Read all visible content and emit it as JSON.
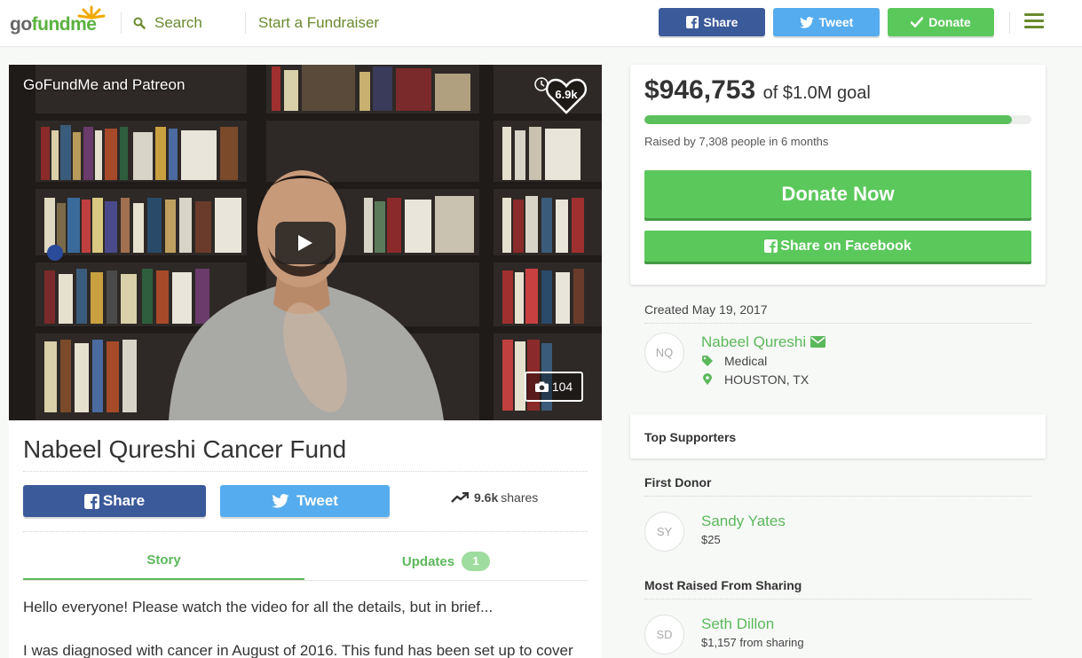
{
  "header": {
    "logo_go": "go",
    "logo_fund": "fundme",
    "search_label": "Search",
    "start_label": "Start a Fundraiser",
    "share_label": "Share",
    "tweet_label": "Tweet",
    "donate_label": "Donate",
    "colors": {
      "facebook": "#3b5a9a",
      "twitter": "#55acee",
      "green": "#5bc85b",
      "olive": "#6a8a2e"
    }
  },
  "video": {
    "title": "GoFundMe and Patreon",
    "hearts": "6.9k",
    "photo_count": "104"
  },
  "campaign": {
    "title": "Nabeel Qureshi Cancer Fund",
    "share_label": "Share",
    "tweet_label": "Tweet",
    "shares_count": "9.6k",
    "shares_label": "shares",
    "tabs": [
      {
        "label": "Story",
        "active": true
      },
      {
        "label": "Updates",
        "badge": "1",
        "active": false
      }
    ],
    "story": [
      "Hello everyone! Please watch the video for all the details, but in brief...",
      "I was diagnosed with cancer in August of 2016. This fund has been set up to cover"
    ]
  },
  "donation": {
    "raised": "$946,753",
    "goal_text": "of $1.0M goal",
    "progress_fraction": 0.95,
    "raised_by": "Raised by 7,308 people in 6 months",
    "donate_now": "Donate Now",
    "share_facebook": "Share on Facebook"
  },
  "organizer": {
    "created": "Created May 19, 2017",
    "initials": "NQ",
    "name": "Nabeel Qureshi",
    "category": "Medical",
    "location": "HOUSTON, TX"
  },
  "supporters": {
    "title": "Top Supporters",
    "first_donor_title": "First Donor",
    "first_donor": {
      "initials": "SY",
      "name": "Sandy Yates",
      "amount": "$25"
    },
    "most_raised_title": "Most Raised From Sharing",
    "most_raised": {
      "initials": "SD",
      "name": "Seth Dillon",
      "amount": "$1,157 from sharing"
    }
  }
}
